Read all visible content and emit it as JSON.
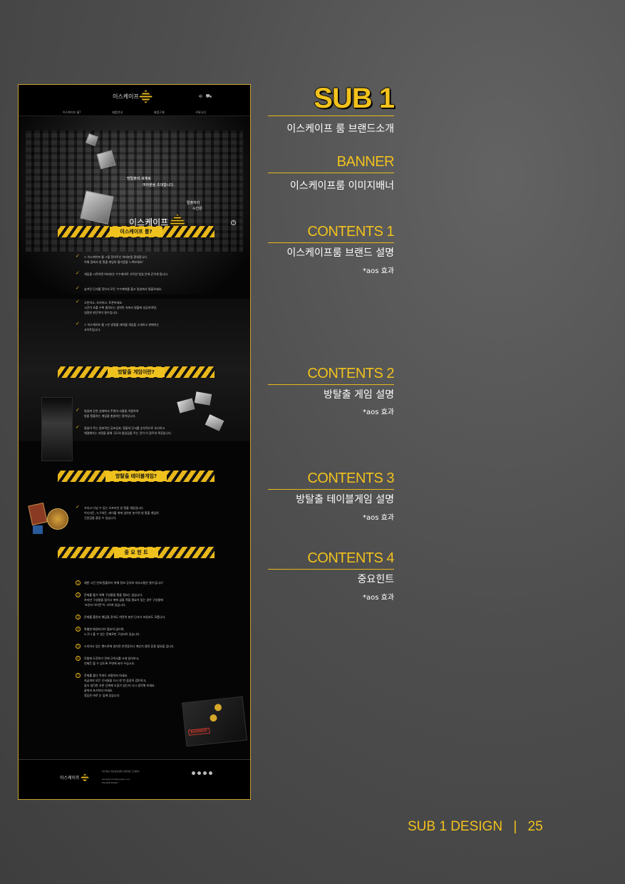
{
  "mockup": {
    "header": {
      "logo": "이스케이프",
      "icons": [
        "login-icon",
        "cart-icon"
      ],
      "nav": [
        "이스케이프 룸?",
        "제품안내",
        "제품구매",
        "커뮤니티"
      ]
    },
    "hero": {
      "line1": "방탈출의 세계로",
      "line2": "여러분을 초대합니다.",
      "line3": "탈출하라",
      "line4": "시간은",
      "logo": "이스케이프"
    },
    "sections": [
      {
        "title": "이스케이프 룸?",
        "items": [
          [
            "< 이스케이프 룸 >을 찾아주신 여러분을 환영합니다.",
            "이제 집에서 방 탈출 게임의 즐거움을 느껴보세요!"
          ],
          [
            "게임을 시작하면 여러분은 수수께끼로 가득한 밀실 안에 갇히게 됩니다."
          ],
          [
            "숨겨진 단서를 찾아서 모든 수수께끼를 풀고 밀실에서 탈출하세요."
          ],
          [
            "고민하고, 추리하고, 토론하세요.",
            "시간이 흐를 수록 좁혀오는 압박된 속에서 탈출에 성공하려면,",
            "냉정한 판단력이 필수입니다."
          ],
          [
            "< 이스케이프 룸 >은 방탈출 테이블 게임을 소개하고 판매하는",
            "사이트입니다."
          ]
        ]
      },
      {
        "title": "방탈출 게임이란?",
        "items": [
          [
            "밀실에 갇힌 상태에서 주변의 사물을 이용하여",
            "방을 탈출하는 게임을 총칭하는 용어입니다."
          ],
          [
            "밀실이 주는 원초적인 공포감과, 탈출의 단서를 순차적으로 추리하고",
            "해결해가는 과정을 통해 극도의 몰입감을 주는 것이 이 장르의 특징입니다."
          ]
        ]
      },
      {
        "title": "방탈출 테이블게임?",
        "items": [
          [
            "가지고 다닐 수 있는 오프라인 방 탈출 게임입니다.",
            "어디서든, 누구와든, 테이블 위에 앉아만 놓으면 방 탈출 게임의",
            "긴장감을 즐길 수 있습니다."
          ]
        ]
      },
      {
        "title": "중 요 힌 트",
        "hints": [
          [
            "제한 시간 안에 탈출하기 위해 정보 공유와 의사소통은 필수입니다!"
          ],
          [
            "문제를 풀기 위해 구성물을 찢을 필요는 없습니다.",
            "하지만 구성물을 접거나 위에 글을 적을 필요가 있는 경우 구성물에",
            "'조인터 아이콘'이 그려져 있습니다."
          ],
          [
            "문제를 풀면서 해답을 찾아도 여전히 놓친 단서가 보일지도 모릅니다."
          ],
          [
            "특별한 배경지식이 필요치 않으며,",
            "누구나 풀 수 있는 문제로만 구성되어 있습니다."
          ],
          [
            "소지하고 있는 핸드폰에 설치된 손전등이나 계산기 앱의 휴용 될요할 겁니다."
          ],
          [
            "모험에 도전하기 전에 규칙서를 크게 읽어보고,",
            "언제든 볼 수 있도록 주변에 놓아 두십시오."
          ],
          [
            "문제를 풀다 막혀도 좌절하지 마세요.",
            "지금까지 모든 단서들을 다시 한 번 꼼꼼히 검토하고,",
            "앞서 생각한 추론 단계에 오류가 있는지 다시 생각해 보세요.",
            "끝까지 포기하지 마세요.",
            "정답은 바로 눈 앞에 있습니다."
          ]
        ],
        "stamp": "BANNED"
      }
    ],
    "footer": {
      "logo": "이스케이프",
      "links": "회사정보 개인정보방침 이용약관 고객문의",
      "email": "escaperoom@escape.com",
      "copy": "ESCAPE ROOM"
    }
  },
  "annotations": {
    "sub_title": "SUB 1",
    "sub_desc": "이스케이프 룸 브랜드소개",
    "blocks": [
      {
        "head": "BANNER",
        "desc": "이스케이프룸 이미지배너",
        "note": ""
      },
      {
        "head": "CONTENTS 1",
        "desc": "이스케이프룸 브랜드 설명",
        "note": "*aos 효과"
      },
      {
        "head": "CONTENTS 2",
        "desc": "방탈출 게임 설명",
        "note": "*aos 효과"
      },
      {
        "head": "CONTENTS 3",
        "desc": "방탈출 테이블게임 설명",
        "note": "*aos 효과"
      },
      {
        "head": "CONTENTS 4",
        "desc": "중요힌트",
        "note": "*aos 효과"
      }
    ]
  },
  "footer": {
    "label": "SUB 1 DESIGN",
    "separator": "|",
    "page": "25"
  },
  "colors": {
    "accent": "#f2c21c",
    "background": "#4e4e4e",
    "mockup_bg": "#050505"
  }
}
